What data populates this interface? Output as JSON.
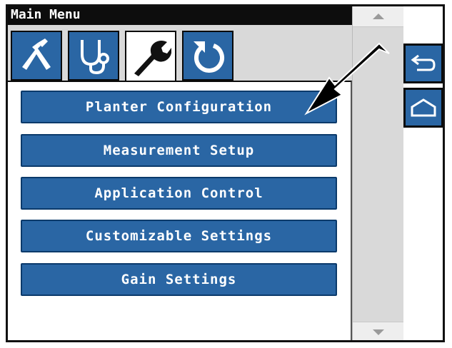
{
  "window": {
    "title": "Main Menu"
  },
  "tabs": [
    {
      "name": "tools-tab",
      "icon": "caliper-tool-icon",
      "active": false
    },
    {
      "name": "diagnostics-tab",
      "icon": "stethoscope-icon",
      "active": false
    },
    {
      "name": "setup-tab",
      "icon": "wrench-icon",
      "active": true
    },
    {
      "name": "reset-tab",
      "icon": "refresh-icon",
      "active": false
    }
  ],
  "menu": {
    "items": [
      {
        "label": "Planter Configuration"
      },
      {
        "label": "Measurement Setup"
      },
      {
        "label": "Application Control"
      },
      {
        "label": "Customizable Settings"
      },
      {
        "label": "Gain Settings"
      }
    ]
  },
  "side_buttons": {
    "back_icon": "back-arrow-icon",
    "home_icon": "home-icon"
  },
  "colors": {
    "button_blue": "#2a66a4",
    "title_bar": "#0d0d0d",
    "background_gray": "#d9d9d9"
  }
}
